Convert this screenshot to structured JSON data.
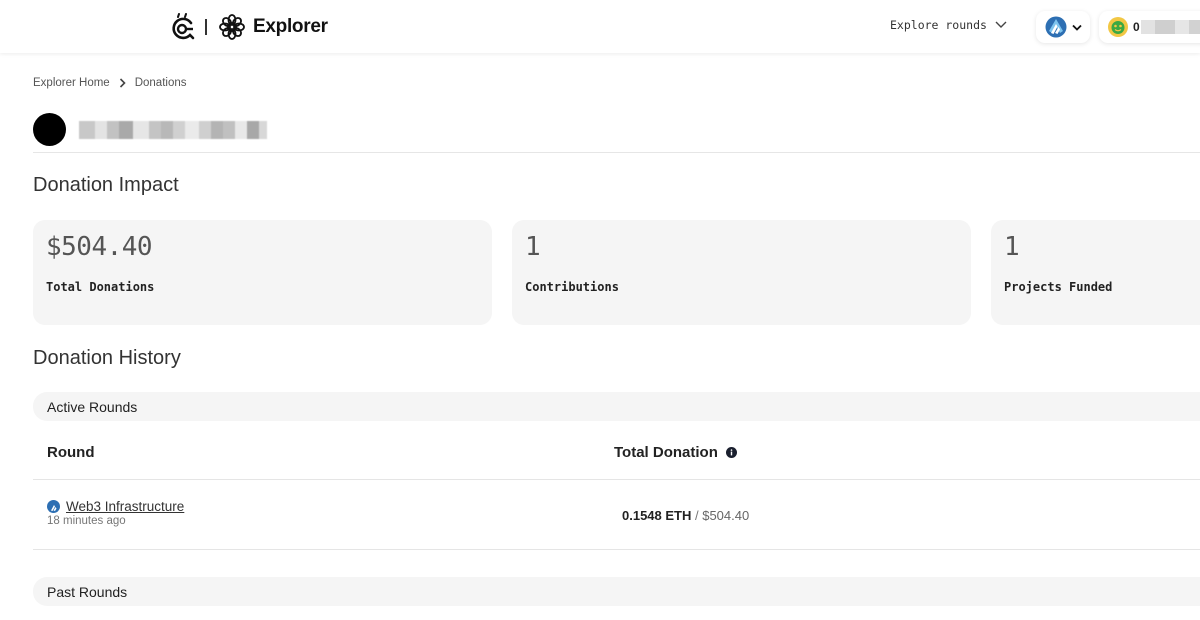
{
  "header": {
    "logo_text": "Explorer",
    "explore_rounds_label": "Explore rounds",
    "account_prefix": "0"
  },
  "breadcrumb": {
    "items": [
      "Explorer Home",
      "Donations"
    ]
  },
  "donation_impact": {
    "title": "Donation Impact",
    "stats": [
      {
        "value": "$504.40",
        "label": "Total Donations"
      },
      {
        "value": "1",
        "label": "Contributions"
      },
      {
        "value": "1",
        "label": "Projects Funded"
      }
    ]
  },
  "donation_history": {
    "title": "Donation History",
    "active_rounds_label": "Active Rounds",
    "past_rounds_label": "Past Rounds",
    "columns": {
      "round": "Round",
      "total_donation": "Total Donation"
    },
    "rows": [
      {
        "round_name": "Web3 Infrastructure",
        "time": "18 minutes ago",
        "amount_eth": "0.1548 ETH",
        "separator": " / ",
        "amount_usd": "$504.40"
      }
    ]
  },
  "colors": {
    "card_bg": "#f5f5f5",
    "chain_blue": "#2d6fb3",
    "avatar_yellow": "#f2c744"
  }
}
